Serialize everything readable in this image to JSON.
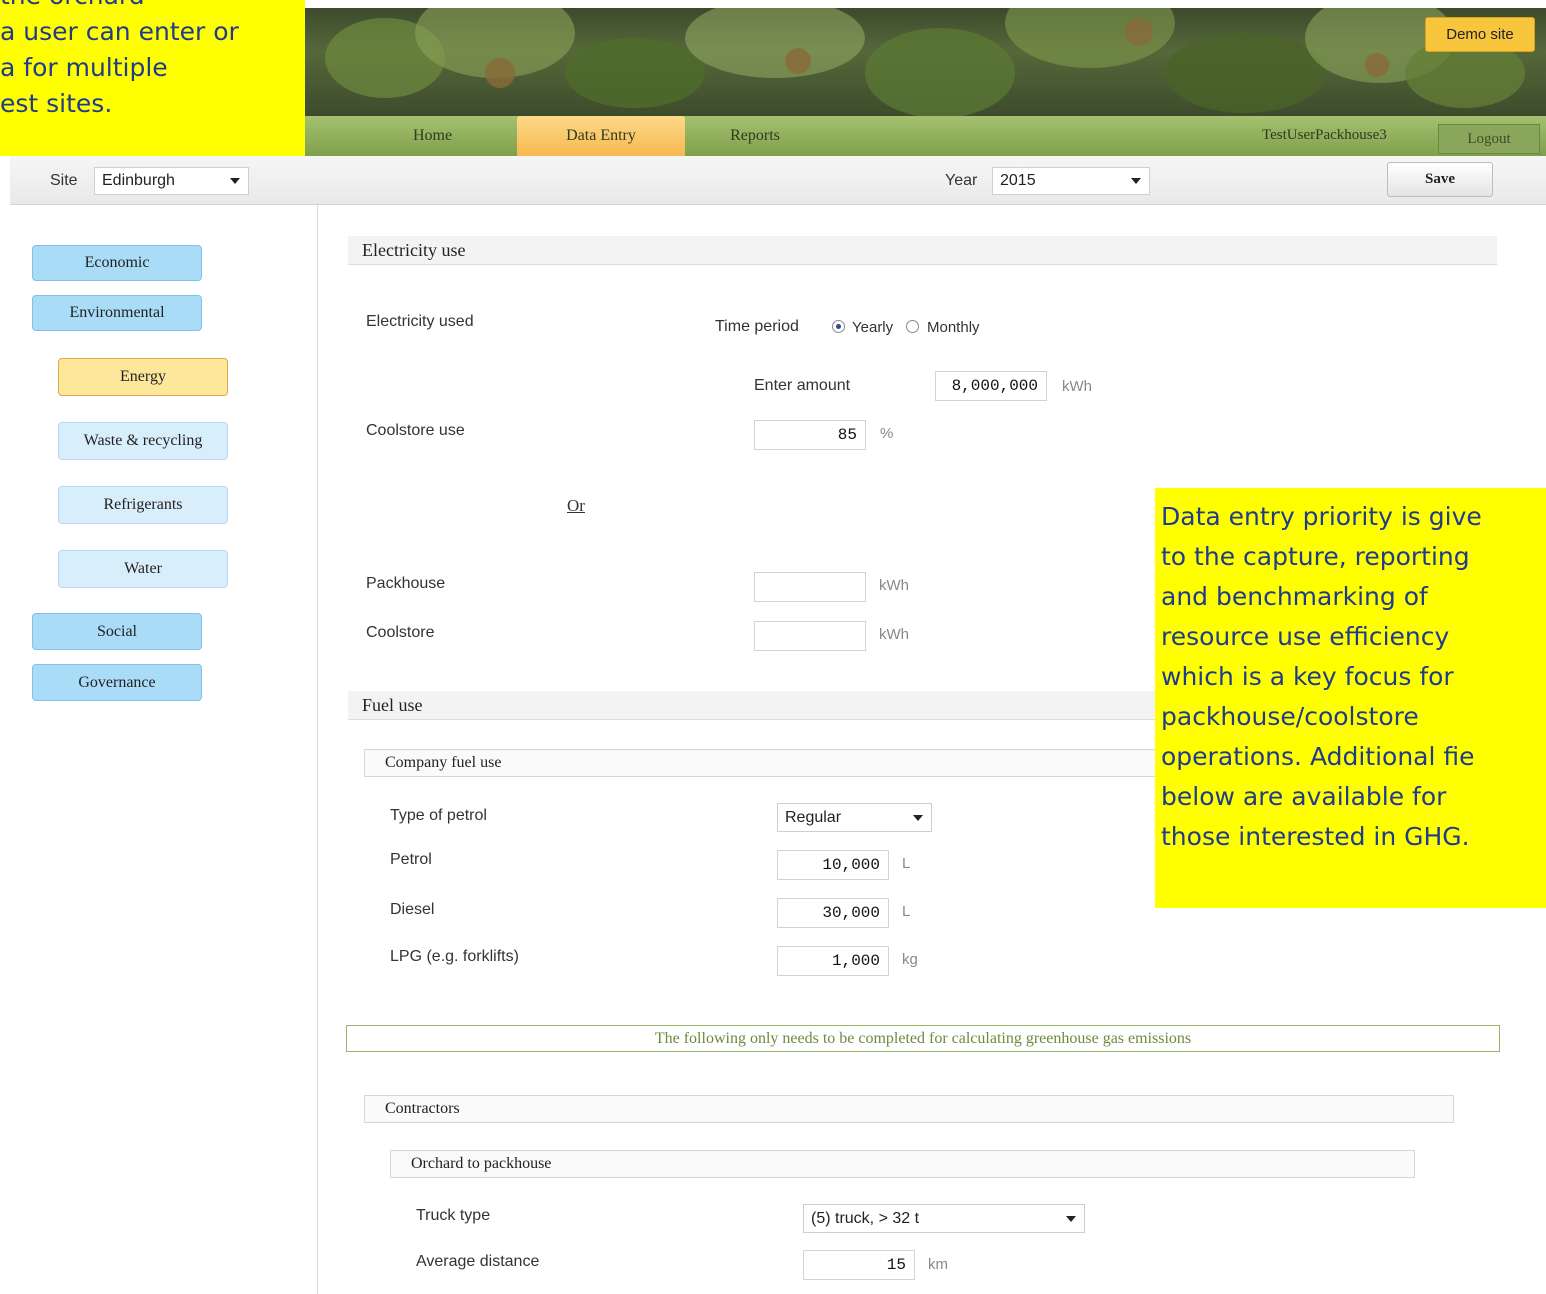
{
  "callouts": {
    "top_left_lines": [
      "the orchard",
      "a user can enter or",
      "a for multiple",
      "est sites."
    ],
    "right_lines": [
      "Data entry priority is give",
      "to the capture, reporting",
      "and benchmarking of",
      "resource use efficiency",
      "which is a key focus for",
      "packhouse/coolstore",
      "operations. Additional fie",
      "below are available for",
      "those interested in GHG."
    ]
  },
  "header": {
    "demo_label": "Demo site",
    "nav": {
      "home": "Home",
      "data_entry": "Data Entry",
      "reports": "Reports"
    },
    "user": "TestUserPackhouse3",
    "logout": "Logout"
  },
  "toolbar": {
    "site_label": "Site",
    "site_value": "Edinburgh",
    "year_label": "Year",
    "year_value": "2015",
    "save": "Save"
  },
  "sidebar": {
    "economic": "Economic",
    "environmental": "Environmental",
    "energy": "Energy",
    "waste": "Waste & recycling",
    "refrigerants": "Refrigerants",
    "water": "Water",
    "social": "Social",
    "governance": "Governance"
  },
  "electricity": {
    "title": "Electricity use",
    "used_label": "Electricity used",
    "time_period_label": "Time period",
    "yearly": "Yearly",
    "monthly": "Monthly",
    "enter_amount_label": "Enter amount",
    "amount": "8,000,000",
    "amount_unit": "kWh",
    "coolstore_use_label": "Coolstore use",
    "coolstore_use": "85",
    "coolstore_use_unit": "%",
    "or_label": "Or",
    "packhouse_label": "Packhouse",
    "packhouse_unit": "kWh",
    "coolstore_label": "Coolstore",
    "coolstore_unit": "kWh"
  },
  "fuel": {
    "title": "Fuel use",
    "company_title": "Company fuel use",
    "petrol_type_label": "Type of petrol",
    "petrol_type": "Regular",
    "petrol_label": "Petrol",
    "petrol": "10,000",
    "petrol_unit": "L",
    "diesel_label": "Diesel",
    "diesel": "30,000",
    "diesel_unit": "L",
    "lpg_label": "LPG (e.g. forklifts)",
    "lpg": "1,000",
    "lpg_unit": "kg"
  },
  "ghg_note": "The following only needs to be completed for calculating greenhouse gas emissions",
  "contractors": {
    "title": "Contractors",
    "orchard_title": "Orchard to packhouse",
    "truck_type_label": "Truck type",
    "truck_type": "(5) truck, > 32 t",
    "distance_label": "Average distance",
    "distance": "15",
    "distance_unit": "km"
  }
}
